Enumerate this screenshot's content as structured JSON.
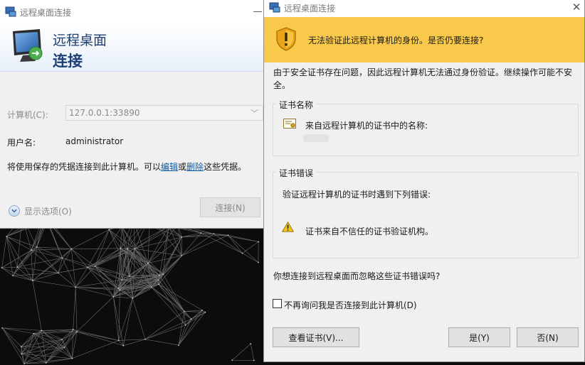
{
  "rdp_window": {
    "title": "远程桌面连接",
    "minimize_glyph": "—",
    "banner_line1": "远程桌面",
    "banner_line2": "连接",
    "computer_label": "计算机(C):",
    "computer_value": "127.0.0.1:33890",
    "username_label": "用户名:",
    "username_value": "administrator",
    "saved_credentials_prefix": "将使用保存的凭据连接到此计算机。可以",
    "edit_link": "编辑",
    "or_text": "或",
    "delete_link": "删除",
    "saved_credentials_suffix": "这些凭据。",
    "show_options_label": "显示选项(O)",
    "connect_button": "连接(N)",
    "icons": [
      "rdp-monitor-icon",
      "dropdown-arrow-icon",
      "expand-options-icon"
    ]
  },
  "cert_dialog": {
    "title": "远程桌面连接",
    "close_glyph": "✕",
    "warning_text": "无法验证此远程计算机的身份。是否仍要连接?",
    "body_text": "由于安全证书存在问题，因此远程计算机无法通过身份验证。继续操作可能不安全。",
    "cert_name_group_label": "证书名称",
    "cert_name_text": "来自远程计算机的证书中的名称:",
    "cert_errors_group_label": "证书错误",
    "cert_errors_intro": "验证远程计算机的证书时遇到下列错误:",
    "cert_error_item": "证书来自不信任的证书验证机构。",
    "question_text": "你想连接到远程桌面而忽略这些证书错误吗?",
    "dont_ask_label": "不再询问我是否连接到此计算机(D)",
    "dont_ask_checked": false,
    "view_cert_button": "查看证书(V)...",
    "yes_button": "是(Y)",
    "no_button": "否(N)",
    "warning_color": "#f9c94c",
    "icons": [
      "security-shield-icon",
      "certificate-icon",
      "warning-triangle-icon",
      "close-icon"
    ]
  }
}
